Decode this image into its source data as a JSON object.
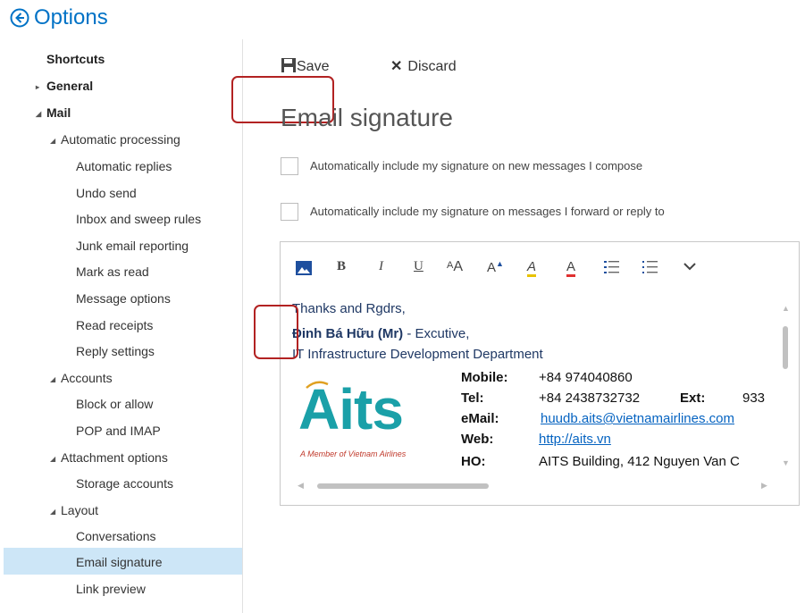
{
  "header": {
    "title": "Options",
    "back_icon": "back-circle-arrow-icon"
  },
  "sidebar": {
    "items": [
      {
        "label": "Shortcuts"
      },
      {
        "label": "General"
      },
      {
        "label": "Mail"
      },
      {
        "label": "Automatic processing"
      },
      {
        "label": "Automatic replies"
      },
      {
        "label": "Undo send"
      },
      {
        "label": "Inbox and sweep rules"
      },
      {
        "label": "Junk email reporting"
      },
      {
        "label": "Mark as read"
      },
      {
        "label": "Message options"
      },
      {
        "label": "Read receipts"
      },
      {
        "label": "Reply settings"
      },
      {
        "label": "Accounts"
      },
      {
        "label": "Block or allow"
      },
      {
        "label": "POP and IMAP"
      },
      {
        "label": "Attachment options"
      },
      {
        "label": "Storage accounts"
      },
      {
        "label": "Layout"
      },
      {
        "label": "Conversations"
      },
      {
        "label": "Email signature"
      },
      {
        "label": "Link preview"
      }
    ]
  },
  "toolbar": {
    "save_label": "Save",
    "discard_label": "Discard"
  },
  "main": {
    "title": "Email signature",
    "checkbox_new": "Automatically include my signature on new messages I compose",
    "checkbox_reply": "Automatically include my signature on messages I forward or reply to"
  },
  "editor": {
    "toolbar": {
      "bold": "B",
      "italic": "I",
      "underline": "U",
      "font_size": "A",
      "grow": "A",
      "highlight": "A",
      "font_color": "A"
    },
    "signature": {
      "greeting": "Thanks and Rgdrs,",
      "name": "Đinh Bá Hữu (Mr)",
      "role": " - Excutive,",
      "department": "IT Infrastructure Development Department",
      "logo_text": "Aits",
      "logo_tagline": "A Member of Vietnam Airlines",
      "fields": [
        {
          "label": "Mobile:",
          "value": "+84 974040860"
        },
        {
          "label": "Tel:",
          "value": "+84 2438732732"
        },
        {
          "label": "eMail:",
          "value": "huudb.aits@vietnamairlines.com"
        },
        {
          "label": "Web:",
          "value": "http://aits.vn"
        },
        {
          "label": "HO:",
          "value": "AITS Building, 412 Nguyen Van C"
        }
      ],
      "ext_label": "Ext:",
      "ext_value": "933"
    }
  },
  "colors": {
    "accent": "#0072c6",
    "selected": "#cde6f7",
    "highlight_box": "#b22222",
    "logo": "#1aa0a8"
  }
}
